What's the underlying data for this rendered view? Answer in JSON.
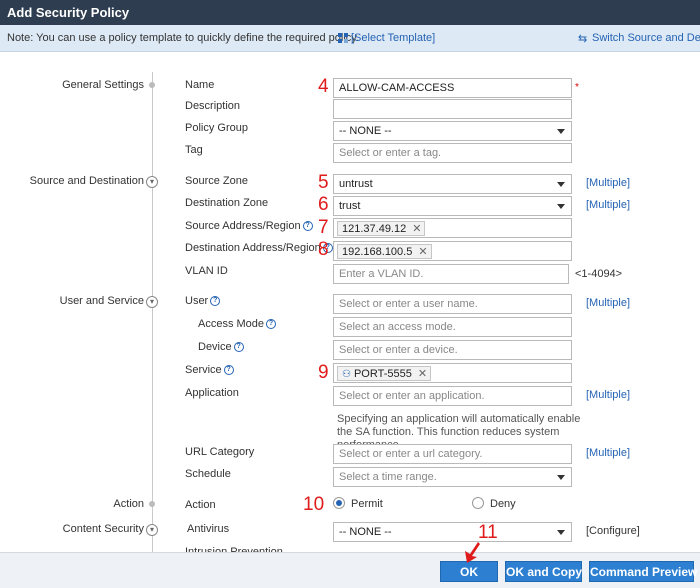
{
  "title": "Add Security Policy",
  "notebar": {
    "note": "Note: You can use a policy template to quickly define the required policy.",
    "select_template": "[Select Template]",
    "switch": "Switch Source and Desti"
  },
  "sections": {
    "general": "General Settings",
    "source_dest": "Source and Destination",
    "user_service": "User and Service",
    "action": "Action",
    "content_security": "Content Security"
  },
  "general": {
    "name_label": "Name",
    "name_value": "ALLOW-CAM-ACCESS",
    "required_mark": "*",
    "description_label": "Description",
    "description_value": "",
    "policy_group_label": "Policy Group",
    "policy_group_value": "-- NONE --",
    "tag_label": "Tag",
    "tag_placeholder": "Select or enter a tag."
  },
  "source_dest": {
    "source_zone_label": "Source Zone",
    "source_zone_value": "untrust",
    "dest_zone_label": "Destination Zone",
    "dest_zone_value": "trust",
    "source_addr_label": "Source Address/Region",
    "source_addr_tag": "121.37.49.12",
    "dest_addr_label": "Destination Address/Region",
    "dest_addr_tag": "192.168.100.5",
    "vlan_label": "VLAN ID",
    "vlan_placeholder": "Enter a VLAN ID.",
    "vlan_hint": "<1-4094>",
    "multiple": "[Multiple]"
  },
  "user_service": {
    "user_label": "User",
    "user_placeholder": "Select or enter a user name.",
    "access_mode_label": "Access Mode",
    "access_mode_placeholder": "Select an access mode.",
    "device_label": "Device",
    "device_placeholder": "Select or enter a device.",
    "service_label": "Service",
    "service_tag": "PORT-5555",
    "application_label": "Application",
    "application_placeholder": "Select or enter an application.",
    "application_info": "Specifying an application will automatically enable the SA function. This function reduces system performance.",
    "url_label": "URL Category",
    "url_placeholder": "Select or enter a url category.",
    "schedule_label": "Schedule",
    "schedule_placeholder": "Select a time range."
  },
  "action": {
    "label": "Action",
    "permit": "Permit",
    "deny": "Deny"
  },
  "content": {
    "antivirus_label": "Antivirus",
    "antivirus_value": "-- NONE --",
    "configure": "[Configure]",
    "next_row_label": "Intrusion Prevention"
  },
  "annotations": [
    "4",
    "5",
    "6",
    "7",
    "8",
    "9",
    "10",
    "11"
  ],
  "buttons": {
    "ok": "OK",
    "ok_copy": "OK and Copy",
    "preview": "Command Preview"
  },
  "colors": {
    "title_bg": "#2e3d4f",
    "note_bg": "#dde9f5",
    "link": "#2563b4",
    "button": "#2c7fd1",
    "annotation": "#e01b1b"
  }
}
